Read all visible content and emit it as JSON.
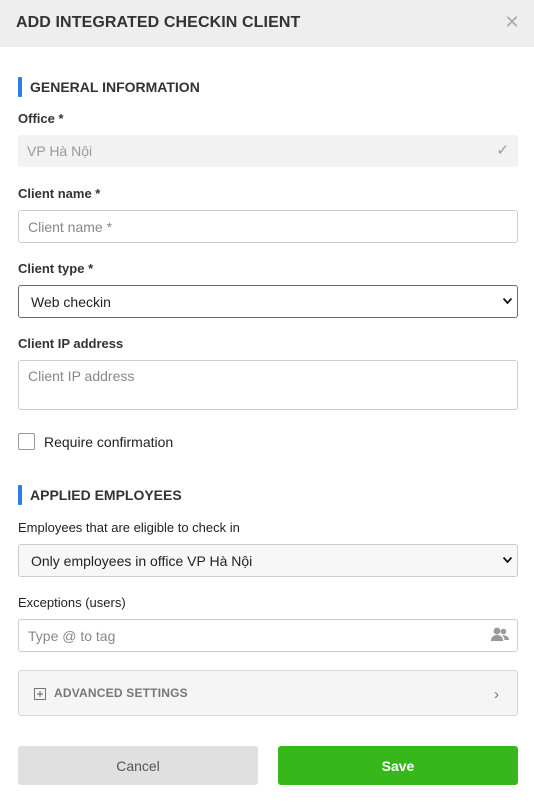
{
  "dialog": {
    "title": "ADD INTEGRATED CHECKIN CLIENT",
    "close_icon": "close-icon"
  },
  "general_section": {
    "title": "GENERAL INFORMATION",
    "accent_color": "#2a7de1"
  },
  "office": {
    "label": "Office *",
    "value": "VP Hà Nội"
  },
  "client_name": {
    "label": "Client name *",
    "placeholder": "Client name *",
    "value": ""
  },
  "client_type": {
    "label": "Client type *",
    "value": "Web checkin"
  },
  "client_ip": {
    "label": "Client IP address",
    "placeholder": "Client IP address",
    "value": ""
  },
  "require_confirmation": {
    "label": "Require confirmation",
    "checked": false
  },
  "employees_section": {
    "title": "APPLIED EMPLOYEES"
  },
  "eligible": {
    "label": "Employees that are eligible to check in",
    "value": "Only employees in office VP Hà Nội"
  },
  "exceptions": {
    "label": "Exceptions (users)",
    "placeholder": "Type @ to tag",
    "icon": "users-icon"
  },
  "advanced": {
    "label": "ADVANCED SETTINGS"
  },
  "actions": {
    "cancel_label": "Cancel",
    "save_label": "Save",
    "save_color": "#36b81a"
  }
}
